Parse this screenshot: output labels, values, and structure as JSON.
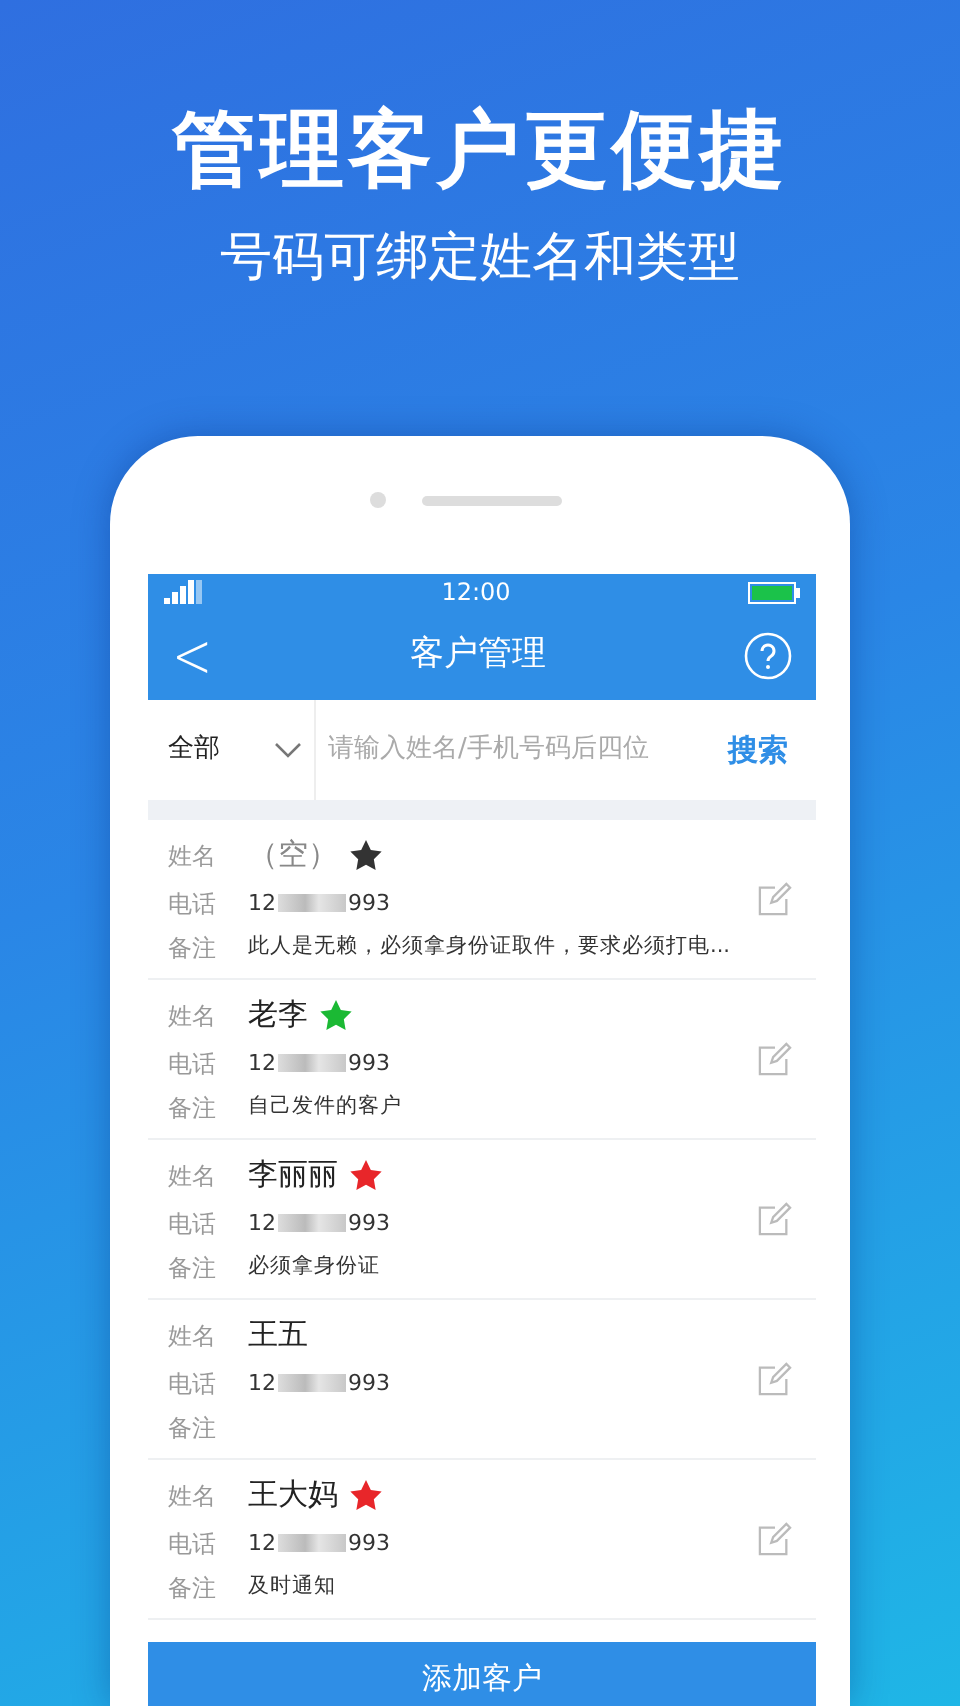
{
  "hero": {
    "title": "管理客户更便捷",
    "subtitle": "号码可绑定姓名和类型"
  },
  "status_bar": {
    "time": "12:00",
    "battery": {
      "level": 1
    }
  },
  "nav": {
    "back": "<",
    "title": "客户管理"
  },
  "filter": {
    "label": "全部"
  },
  "search": {
    "placeholder": "请输入姓名/手机号码后四位",
    "button": "搜索"
  },
  "customers": [
    {
      "name_label": "姓名",
      "name": "（空）",
      "kind": "empty",
      "color": "#333333",
      "phone_label": "电话",
      "phone_start": "12",
      "phone_end": "993",
      "note_label": "备注",
      "note": "此人是无赖，必须拿身份证取件，要求必须打电..."
    },
    {
      "name_label": "姓名",
      "name": "老李",
      "kind": "named",
      "color": "#1bb934",
      "phone_label": "电话",
      "phone_start": "12",
      "phone_end": "993",
      "note_label": "备注",
      "note": "自己发件的客户"
    },
    {
      "name_label": "姓名",
      "name": "李丽丽",
      "kind": "named",
      "color": "#e8262a",
      "phone_label": "电话",
      "phone_start": "12",
      "phone_end": "993",
      "note_label": "备注",
      "note": "必须拿身份证"
    },
    {
      "name_label": "姓名",
      "name": "王五",
      "kind": "named",
      "phone_label": "电话",
      "phone_start": "12",
      "phone_end": "993",
      "note_label": "备注"
    },
    {
      "name_label": "姓名",
      "name": "王大妈",
      "kind": "named",
      "color": "#e8262a",
      "phone_label": "电话",
      "phone_start": "12",
      "phone_end": "993",
      "note_label": "备注",
      "note": "及时通知"
    }
  ],
  "add_button": "添加客户"
}
